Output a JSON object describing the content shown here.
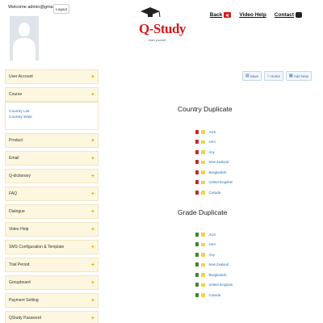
{
  "header": {
    "welcome": "Welcome admin@gmail.com",
    "logout_label": "Logout",
    "logo_text": "Q-Study",
    "logo_tagline": "learn yourself...",
    "links": {
      "back": "Back",
      "video_help": "Video Help",
      "contact": "Contact"
    }
  },
  "sidebar": {
    "items": [
      {
        "label": "User Account"
      },
      {
        "label": "Course"
      },
      {
        "label": "Product"
      },
      {
        "label": "Email"
      },
      {
        "label": "Q-dictionary"
      },
      {
        "label": "FAQ"
      },
      {
        "label": "Dialogue"
      },
      {
        "label": "Video Help"
      },
      {
        "label": "SMS Configuration & Template"
      },
      {
        "label": "Trial Period"
      },
      {
        "label": "Groupboard"
      },
      {
        "label": "Payment Setting"
      },
      {
        "label": "QStudy Password"
      }
    ],
    "course_sub": [
      "Country List",
      "Country Wise"
    ]
  },
  "toolbar": {
    "save": "Save",
    "home": "Home",
    "add_new": "Add New"
  },
  "country_section": {
    "title": "Country Duplicate",
    "items": [
      "AUS",
      "USA",
      "Any",
      "New Zealand",
      "Bangladesh",
      "United Kingdom",
      "Canada"
    ]
  },
  "grade_section": {
    "title": "Grade Duplicate",
    "items": [
      "AUS",
      "USA",
      "Any",
      "New Zealand",
      "Bangladesh",
      "United Kingdom",
      "Canada"
    ]
  },
  "colors": {
    "sidebar_bg": "#fdf7e0",
    "link": "#2a6ebb",
    "brand_red": "#d61a1a",
    "plus_yellow": "#e0b000"
  }
}
